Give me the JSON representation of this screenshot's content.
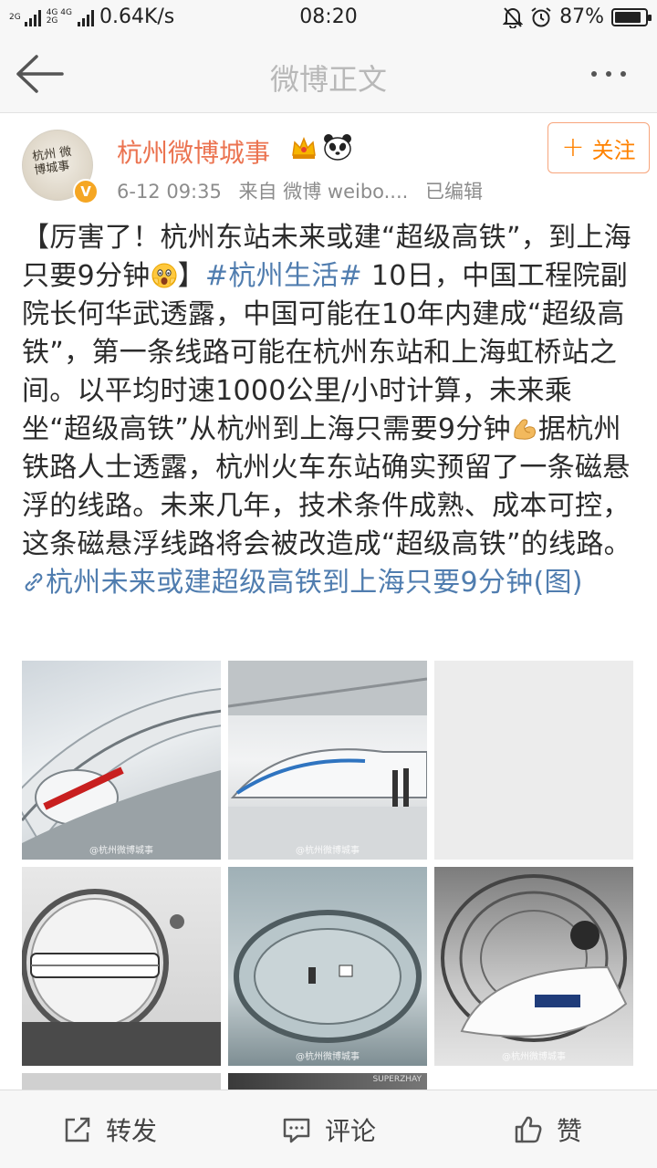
{
  "status_bar": {
    "net_top": "4G 4G",
    "net_bottom": "2G",
    "left_tag": "2G",
    "speed": "0.64K/s",
    "time": "08:20",
    "battery_text": "87%",
    "battery_level": 0.87
  },
  "nav": {
    "title": "微博正文"
  },
  "post": {
    "author_name": "杭州微博城事",
    "avatar_text": "杭州 微博城事",
    "timestamp": "6-12 09:35",
    "source": "来自 微博 weibo....",
    "edited": "已编辑",
    "follow_label": "关注",
    "text": {
      "p1": "【厉害了！杭州东站未来或建“超级高铁”，到上海只要9分钟",
      "p2": "】",
      "hashtag": "#杭州生活#",
      "p3": " 10日，中国工程院副院长何华武透露，中国可能在10年内建成“超级高铁”，第一条线路可能在杭州东站和上海虹桥站之间。以平均时速1000公里/小时计算，未来乘坐“超级高铁”从杭州到上海只需要9分钟",
      "p4": "据杭州铁路人士透露，杭州火车东站确实预留了一条磁悬浮的线路。未来几年，技术条件成熟、成本可控，这条磁悬浮线路将会被改造成“超级高铁”的线路。",
      "link": "杭州未来或建超级高铁到上海只要9分钟(图)"
    },
    "images": [
      {
        "watermark": "@杭州微博城事"
      },
      {
        "watermark": "@杭州微博城事"
      },
      {
        "watermark": ""
      },
      {
        "watermark": ""
      },
      {
        "watermark": "@杭州微博城事"
      },
      {
        "watermark": "@杭州微博城事"
      }
    ],
    "partial_image_label": "SUPERZHAY"
  },
  "actions": {
    "repost": "转发",
    "comment": "评论",
    "like": "赞"
  }
}
